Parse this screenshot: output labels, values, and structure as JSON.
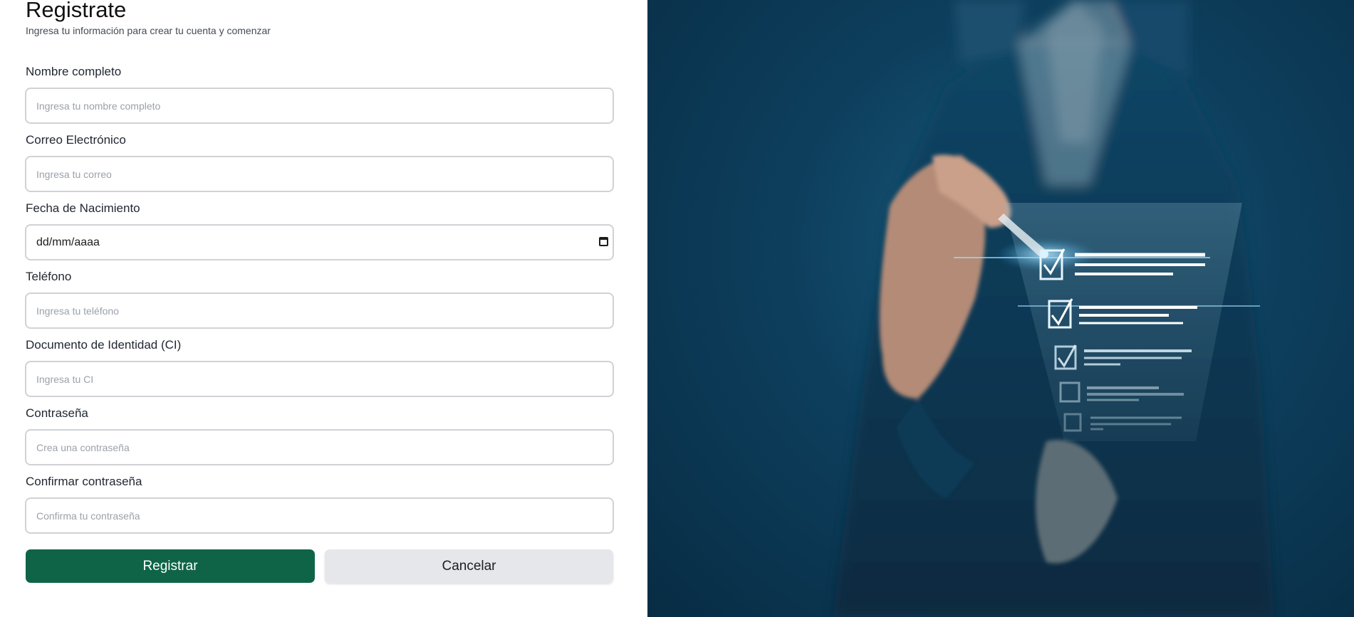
{
  "form": {
    "title": "Registrate",
    "subtitle": "Ingresa tu información para crear tu cuenta y comenzar",
    "fields": [
      {
        "label": "Nombre completo",
        "placeholder": "Ingresa tu nombre completo"
      },
      {
        "label": "Correo Electrónico",
        "placeholder": "Ingresa tu correo"
      },
      {
        "label": "Fecha de Nacimiento",
        "value": "dd/mm/aaaa"
      },
      {
        "label": "Teléfono",
        "placeholder": "Ingresa tu teléfono"
      },
      {
        "label": "Documento de Identidad (CI)",
        "placeholder": "Ingresa tu CI"
      },
      {
        "label": "Contraseña",
        "placeholder": "Crea una contraseña"
      },
      {
        "label": "Confirmar contraseña",
        "placeholder": "Confirma tu contraseña"
      }
    ],
    "buttons": {
      "submit": "Registrar",
      "cancel": "Cancelar"
    }
  },
  "icons": {
    "date_picker": "calendar-icon",
    "illustration_checks": "checkbox-icon"
  },
  "colors": {
    "primary_button": "#0f6448",
    "secondary_button": "#e6e7eb",
    "image_background": "#0d3f5d"
  }
}
